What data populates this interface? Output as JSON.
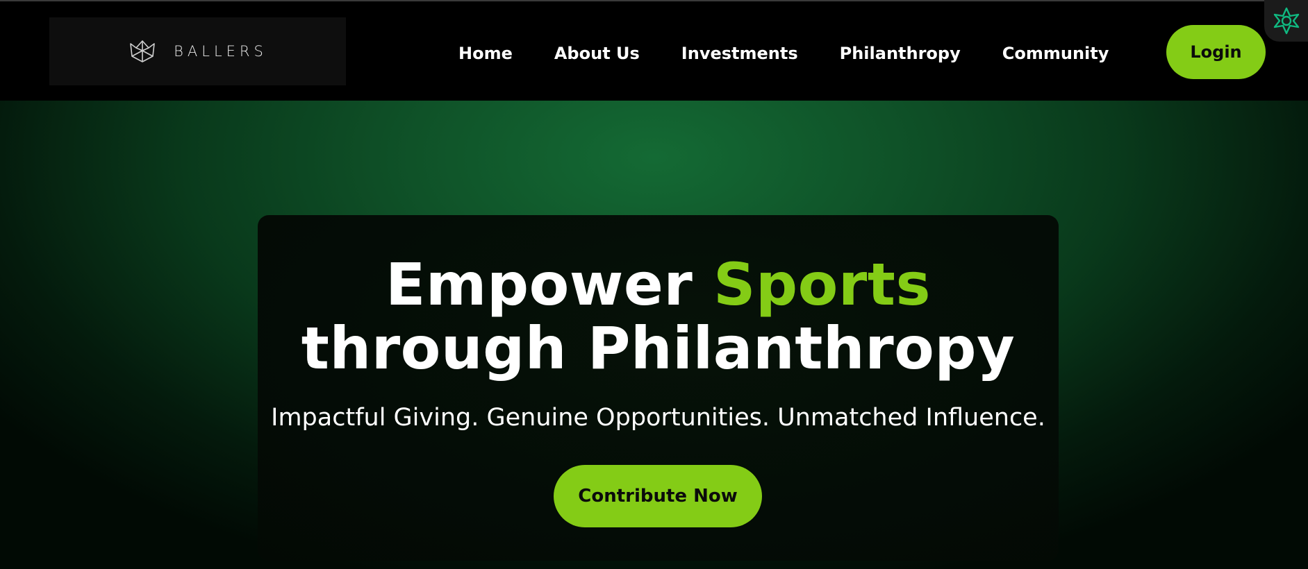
{
  "brand": {
    "name": "BALLERS",
    "logo_icon": "crown-gem-icon"
  },
  "nav": {
    "items": [
      {
        "label": "Home"
      },
      {
        "label": "About Us"
      },
      {
        "label": "Investments"
      },
      {
        "label": "Philanthropy"
      },
      {
        "label": "Community"
      }
    ],
    "login_label": "Login"
  },
  "assistant": {
    "icon": "ai-assistant-icon"
  },
  "hero": {
    "title_part1": "Empower ",
    "title_accent": "Sports",
    "title_line2": "through Philanthropy",
    "subtitle": "Impactful Giving. Genuine Opportunities. Unmatched Influence.",
    "cta_label": "Contribute Now"
  },
  "colors": {
    "accent": "#84cc16",
    "background": "#000000",
    "hero_green": "#146a34",
    "card": "#050e07"
  }
}
